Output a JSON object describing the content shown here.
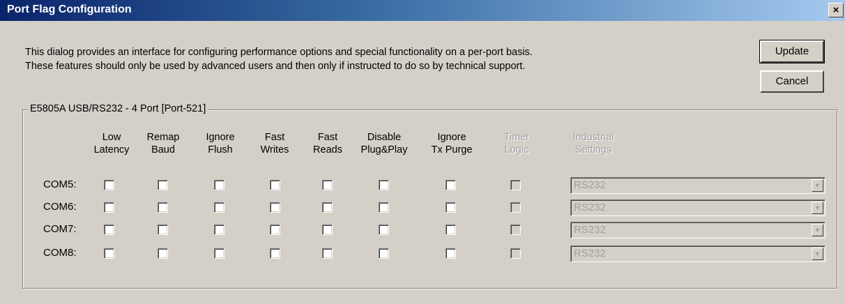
{
  "window": {
    "title": "Port Flag Configuration",
    "close_label": "×"
  },
  "description": {
    "line1": "This dialog provides an interface for configuring performance options and special functionality on a per-port basis.",
    "line2": "These features should only be used by advanced users and then only if instructed to do so by technical support."
  },
  "buttons": {
    "update": "Update",
    "cancel": "Cancel"
  },
  "group": {
    "label": "E5805A USB/RS232 - 4 Port [Port-521]"
  },
  "columns": [
    {
      "line1": "Low",
      "line2": "Latency",
      "enabled": true
    },
    {
      "line1": "Remap",
      "line2": "Baud",
      "enabled": true
    },
    {
      "line1": "Ignore",
      "line2": "Flush",
      "enabled": true
    },
    {
      "line1": "Fast",
      "line2": "Writes",
      "enabled": true
    },
    {
      "line1": "Fast",
      "line2": "Reads",
      "enabled": true
    },
    {
      "line1": "Disable",
      "line2": "Plug&Play",
      "enabled": true
    },
    {
      "line1": "Ignore",
      "line2": "Tx Purge",
      "enabled": true
    },
    {
      "line1": "Timer",
      "line2": "Logic",
      "enabled": false
    },
    {
      "line1": "Industrial",
      "line2": "Settings",
      "enabled": false
    }
  ],
  "rows": [
    {
      "port": "COM5:",
      "industrial": "RS232"
    },
    {
      "port": "COM6:",
      "industrial": "RS232"
    },
    {
      "port": "COM7:",
      "industrial": "RS232"
    },
    {
      "port": "COM8:",
      "industrial": "RS232"
    }
  ],
  "colors": {
    "title_start": "#0a246a",
    "title_end": "#a6caf0",
    "disabled_text": "#a0a0a0"
  },
  "icons": {
    "combo_arrow": "chevron-down-icon"
  }
}
